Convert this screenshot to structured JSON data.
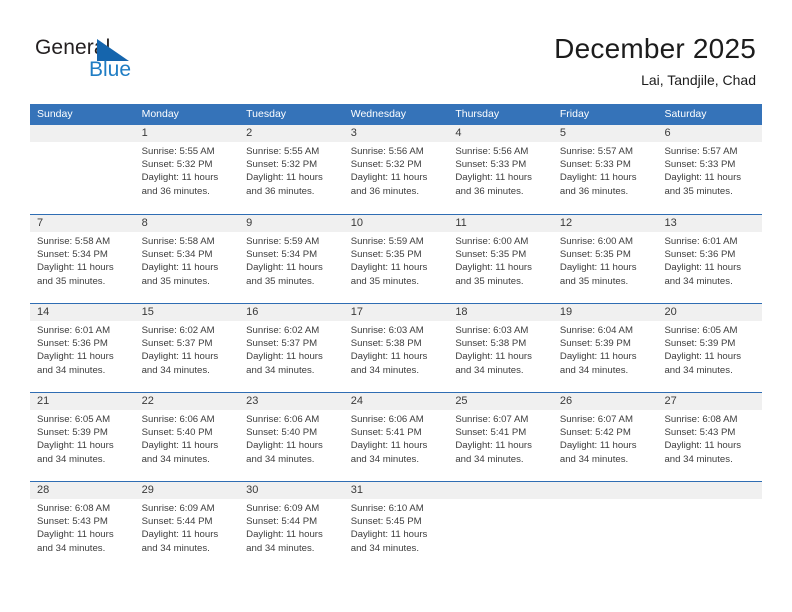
{
  "logo": {
    "word1": "General",
    "word2": "Blue",
    "triangle_color": "#1565ad",
    "blue_color": "#1f7dc4",
    "dark_color": "#231f20"
  },
  "header": {
    "title": "December 2025",
    "subtitle": "Lai, Tandjile, Chad"
  },
  "theme": {
    "header_band": "#3573b9",
    "week_divider": "#2f6db3",
    "daynum_band": "#f0f0f0"
  },
  "weekdays": [
    "Sunday",
    "Monday",
    "Tuesday",
    "Wednesday",
    "Thursday",
    "Friday",
    "Saturday"
  ],
  "weeks": [
    [
      {
        "day": "",
        "sunrise": "",
        "sunset": "",
        "daylight1": "",
        "daylight2": "",
        "empty": true
      },
      {
        "day": "1",
        "sunrise": "Sunrise: 5:55 AM",
        "sunset": "Sunset: 5:32 PM",
        "daylight1": "Daylight: 11 hours",
        "daylight2": "and 36 minutes."
      },
      {
        "day": "2",
        "sunrise": "Sunrise: 5:55 AM",
        "sunset": "Sunset: 5:32 PM",
        "daylight1": "Daylight: 11 hours",
        "daylight2": "and 36 minutes."
      },
      {
        "day": "3",
        "sunrise": "Sunrise: 5:56 AM",
        "sunset": "Sunset: 5:32 PM",
        "daylight1": "Daylight: 11 hours",
        "daylight2": "and 36 minutes."
      },
      {
        "day": "4",
        "sunrise": "Sunrise: 5:56 AM",
        "sunset": "Sunset: 5:33 PM",
        "daylight1": "Daylight: 11 hours",
        "daylight2": "and 36 minutes."
      },
      {
        "day": "5",
        "sunrise": "Sunrise: 5:57 AM",
        "sunset": "Sunset: 5:33 PM",
        "daylight1": "Daylight: 11 hours",
        "daylight2": "and 36 minutes."
      },
      {
        "day": "6",
        "sunrise": "Sunrise: 5:57 AM",
        "sunset": "Sunset: 5:33 PM",
        "daylight1": "Daylight: 11 hours",
        "daylight2": "and 35 minutes."
      }
    ],
    [
      {
        "day": "7",
        "sunrise": "Sunrise: 5:58 AM",
        "sunset": "Sunset: 5:34 PM",
        "daylight1": "Daylight: 11 hours",
        "daylight2": "and 35 minutes."
      },
      {
        "day": "8",
        "sunrise": "Sunrise: 5:58 AM",
        "sunset": "Sunset: 5:34 PM",
        "daylight1": "Daylight: 11 hours",
        "daylight2": "and 35 minutes."
      },
      {
        "day": "9",
        "sunrise": "Sunrise: 5:59 AM",
        "sunset": "Sunset: 5:34 PM",
        "daylight1": "Daylight: 11 hours",
        "daylight2": "and 35 minutes."
      },
      {
        "day": "10",
        "sunrise": "Sunrise: 5:59 AM",
        "sunset": "Sunset: 5:35 PM",
        "daylight1": "Daylight: 11 hours",
        "daylight2": "and 35 minutes."
      },
      {
        "day": "11",
        "sunrise": "Sunrise: 6:00 AM",
        "sunset": "Sunset: 5:35 PM",
        "daylight1": "Daylight: 11 hours",
        "daylight2": "and 35 minutes."
      },
      {
        "day": "12",
        "sunrise": "Sunrise: 6:00 AM",
        "sunset": "Sunset: 5:35 PM",
        "daylight1": "Daylight: 11 hours",
        "daylight2": "and 35 minutes."
      },
      {
        "day": "13",
        "sunrise": "Sunrise: 6:01 AM",
        "sunset": "Sunset: 5:36 PM",
        "daylight1": "Daylight: 11 hours",
        "daylight2": "and 34 minutes."
      }
    ],
    [
      {
        "day": "14",
        "sunrise": "Sunrise: 6:01 AM",
        "sunset": "Sunset: 5:36 PM",
        "daylight1": "Daylight: 11 hours",
        "daylight2": "and 34 minutes."
      },
      {
        "day": "15",
        "sunrise": "Sunrise: 6:02 AM",
        "sunset": "Sunset: 5:37 PM",
        "daylight1": "Daylight: 11 hours",
        "daylight2": "and 34 minutes."
      },
      {
        "day": "16",
        "sunrise": "Sunrise: 6:02 AM",
        "sunset": "Sunset: 5:37 PM",
        "daylight1": "Daylight: 11 hours",
        "daylight2": "and 34 minutes."
      },
      {
        "day": "17",
        "sunrise": "Sunrise: 6:03 AM",
        "sunset": "Sunset: 5:38 PM",
        "daylight1": "Daylight: 11 hours",
        "daylight2": "and 34 minutes."
      },
      {
        "day": "18",
        "sunrise": "Sunrise: 6:03 AM",
        "sunset": "Sunset: 5:38 PM",
        "daylight1": "Daylight: 11 hours",
        "daylight2": "and 34 minutes."
      },
      {
        "day": "19",
        "sunrise": "Sunrise: 6:04 AM",
        "sunset": "Sunset: 5:39 PM",
        "daylight1": "Daylight: 11 hours",
        "daylight2": "and 34 minutes."
      },
      {
        "day": "20",
        "sunrise": "Sunrise: 6:05 AM",
        "sunset": "Sunset: 5:39 PM",
        "daylight1": "Daylight: 11 hours",
        "daylight2": "and 34 minutes."
      }
    ],
    [
      {
        "day": "21",
        "sunrise": "Sunrise: 6:05 AM",
        "sunset": "Sunset: 5:39 PM",
        "daylight1": "Daylight: 11 hours",
        "daylight2": "and 34 minutes."
      },
      {
        "day": "22",
        "sunrise": "Sunrise: 6:06 AM",
        "sunset": "Sunset: 5:40 PM",
        "daylight1": "Daylight: 11 hours",
        "daylight2": "and 34 minutes."
      },
      {
        "day": "23",
        "sunrise": "Sunrise: 6:06 AM",
        "sunset": "Sunset: 5:40 PM",
        "daylight1": "Daylight: 11 hours",
        "daylight2": "and 34 minutes."
      },
      {
        "day": "24",
        "sunrise": "Sunrise: 6:06 AM",
        "sunset": "Sunset: 5:41 PM",
        "daylight1": "Daylight: 11 hours",
        "daylight2": "and 34 minutes."
      },
      {
        "day": "25",
        "sunrise": "Sunrise: 6:07 AM",
        "sunset": "Sunset: 5:41 PM",
        "daylight1": "Daylight: 11 hours",
        "daylight2": "and 34 minutes."
      },
      {
        "day": "26",
        "sunrise": "Sunrise: 6:07 AM",
        "sunset": "Sunset: 5:42 PM",
        "daylight1": "Daylight: 11 hours",
        "daylight2": "and 34 minutes."
      },
      {
        "day": "27",
        "sunrise": "Sunrise: 6:08 AM",
        "sunset": "Sunset: 5:43 PM",
        "daylight1": "Daylight: 11 hours",
        "daylight2": "and 34 minutes."
      }
    ],
    [
      {
        "day": "28",
        "sunrise": "Sunrise: 6:08 AM",
        "sunset": "Sunset: 5:43 PM",
        "daylight1": "Daylight: 11 hours",
        "daylight2": "and 34 minutes."
      },
      {
        "day": "29",
        "sunrise": "Sunrise: 6:09 AM",
        "sunset": "Sunset: 5:44 PM",
        "daylight1": "Daylight: 11 hours",
        "daylight2": "and 34 minutes."
      },
      {
        "day": "30",
        "sunrise": "Sunrise: 6:09 AM",
        "sunset": "Sunset: 5:44 PM",
        "daylight1": "Daylight: 11 hours",
        "daylight2": "and 34 minutes."
      },
      {
        "day": "31",
        "sunrise": "Sunrise: 6:10 AM",
        "sunset": "Sunset: 5:45 PM",
        "daylight1": "Daylight: 11 hours",
        "daylight2": "and 34 minutes."
      },
      {
        "day": "",
        "sunrise": "",
        "sunset": "",
        "daylight1": "",
        "daylight2": "",
        "empty": true
      },
      {
        "day": "",
        "sunrise": "",
        "sunset": "",
        "daylight1": "",
        "daylight2": "",
        "empty": true
      },
      {
        "day": "",
        "sunrise": "",
        "sunset": "",
        "daylight1": "",
        "daylight2": "",
        "empty": true
      }
    ]
  ]
}
